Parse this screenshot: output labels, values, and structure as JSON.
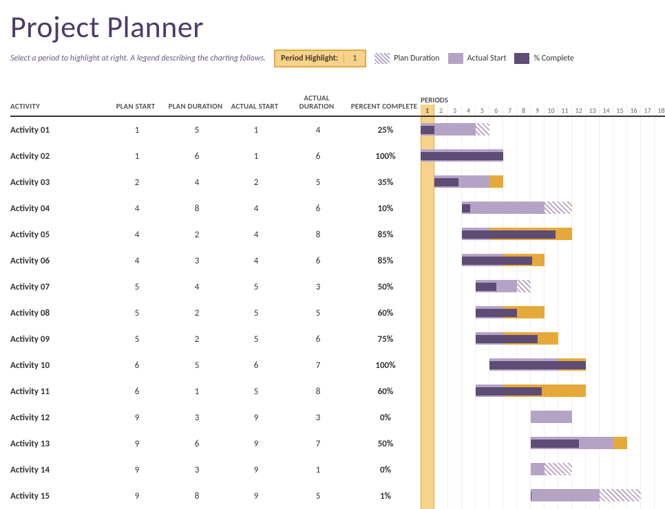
{
  "title": "Project Planner",
  "subtext": "Select a period to highlight at right.  A legend describing the charting follows.",
  "period_highlight_label": "Period Highlight:",
  "period_highlight_value": "1",
  "legend": {
    "plan": "Plan Duration",
    "actual": "Actual Start",
    "complete": "% Complete"
  },
  "columns": {
    "activity": "ACTIVITY",
    "plan_start": "PLAN START",
    "plan_duration": "PLAN DURATION",
    "actual_start": "ACTUAL START",
    "actual_duration": "ACTUAL DURATION",
    "percent_complete": "PERCENT COMPLETE",
    "periods": "PERIODS"
  },
  "period_count": 18,
  "highlight_period": 1,
  "activities": [
    {
      "name": "Activity 01",
      "plan_start": 1,
      "plan_dur": 5,
      "act_start": 1,
      "act_dur": 4,
      "pct": "25%"
    },
    {
      "name": "Activity 02",
      "plan_start": 1,
      "plan_dur": 6,
      "act_start": 1,
      "act_dur": 6,
      "pct": "100%"
    },
    {
      "name": "Activity 03",
      "plan_start": 2,
      "plan_dur": 4,
      "act_start": 2,
      "act_dur": 5,
      "pct": "35%"
    },
    {
      "name": "Activity 04",
      "plan_start": 4,
      "plan_dur": 8,
      "act_start": 4,
      "act_dur": 6,
      "pct": "10%"
    },
    {
      "name": "Activity 05",
      "plan_start": 4,
      "plan_dur": 2,
      "act_start": 4,
      "act_dur": 8,
      "pct": "85%"
    },
    {
      "name": "Activity 06",
      "plan_start": 4,
      "plan_dur": 3,
      "act_start": 4,
      "act_dur": 6,
      "pct": "85%"
    },
    {
      "name": "Activity 07",
      "plan_start": 5,
      "plan_dur": 4,
      "act_start": 5,
      "act_dur": 3,
      "pct": "50%"
    },
    {
      "name": "Activity 08",
      "plan_start": 5,
      "plan_dur": 2,
      "act_start": 5,
      "act_dur": 5,
      "pct": "60%"
    },
    {
      "name": "Activity 09",
      "plan_start": 5,
      "plan_dur": 2,
      "act_start": 5,
      "act_dur": 6,
      "pct": "75%"
    },
    {
      "name": "Activity 10",
      "plan_start": 6,
      "plan_dur": 5,
      "act_start": 6,
      "act_dur": 7,
      "pct": "100%"
    },
    {
      "name": "Activity 11",
      "plan_start": 6,
      "plan_dur": 1,
      "act_start": 5,
      "act_dur": 8,
      "pct": "60%"
    },
    {
      "name": "Activity 12",
      "plan_start": 9,
      "plan_dur": 3,
      "act_start": 9,
      "act_dur": 3,
      "pct": "0%"
    },
    {
      "name": "Activity 13",
      "plan_start": 9,
      "plan_dur": 6,
      "act_start": 9,
      "act_dur": 7,
      "pct": "50%"
    },
    {
      "name": "Activity 14",
      "plan_start": 9,
      "plan_dur": 3,
      "act_start": 9,
      "act_dur": 1,
      "pct": "0%"
    },
    {
      "name": "Activity 15",
      "plan_start": 9,
      "plan_dur": 8,
      "act_start": 9,
      "act_dur": 5,
      "pct": "1%"
    }
  ],
  "chart_data": {
    "type": "gantt",
    "title": "Project Planner",
    "xlabel": "Periods",
    "x_range": [
      1,
      18
    ],
    "legend": [
      "Plan Duration",
      "Actual Start",
      "% Complete"
    ],
    "rows": [
      {
        "name": "Activity 01",
        "plan_start": 1,
        "plan_duration": 5,
        "actual_start": 1,
        "actual_duration": 4,
        "percent_complete": 25
      },
      {
        "name": "Activity 02",
        "plan_start": 1,
        "plan_duration": 6,
        "actual_start": 1,
        "actual_duration": 6,
        "percent_complete": 100
      },
      {
        "name": "Activity 03",
        "plan_start": 2,
        "plan_duration": 4,
        "actual_start": 2,
        "actual_duration": 5,
        "percent_complete": 35
      },
      {
        "name": "Activity 04",
        "plan_start": 4,
        "plan_duration": 8,
        "actual_start": 4,
        "actual_duration": 6,
        "percent_complete": 10
      },
      {
        "name": "Activity 05",
        "plan_start": 4,
        "plan_duration": 2,
        "actual_start": 4,
        "actual_duration": 8,
        "percent_complete": 85
      },
      {
        "name": "Activity 06",
        "plan_start": 4,
        "plan_duration": 3,
        "actual_start": 4,
        "actual_duration": 6,
        "percent_complete": 85
      },
      {
        "name": "Activity 07",
        "plan_start": 5,
        "plan_duration": 4,
        "actual_start": 5,
        "actual_duration": 3,
        "percent_complete": 50
      },
      {
        "name": "Activity 08",
        "plan_start": 5,
        "plan_duration": 2,
        "actual_start": 5,
        "actual_duration": 5,
        "percent_complete": 60
      },
      {
        "name": "Activity 09",
        "plan_start": 5,
        "plan_duration": 2,
        "actual_start": 5,
        "actual_duration": 6,
        "percent_complete": 75
      },
      {
        "name": "Activity 10",
        "plan_start": 6,
        "plan_duration": 5,
        "actual_start": 6,
        "actual_duration": 7,
        "percent_complete": 100
      },
      {
        "name": "Activity 11",
        "plan_start": 6,
        "plan_duration": 1,
        "actual_start": 5,
        "actual_duration": 8,
        "percent_complete": 60
      },
      {
        "name": "Activity 12",
        "plan_start": 9,
        "plan_duration": 3,
        "actual_start": 9,
        "actual_duration": 3,
        "percent_complete": 0
      },
      {
        "name": "Activity 13",
        "plan_start": 9,
        "plan_duration": 6,
        "actual_start": 9,
        "actual_duration": 7,
        "percent_complete": 50
      },
      {
        "name": "Activity 14",
        "plan_start": 9,
        "plan_duration": 3,
        "actual_start": 9,
        "actual_duration": 1,
        "percent_complete": 0
      },
      {
        "name": "Activity 15",
        "plan_start": 9,
        "plan_duration": 8,
        "actual_start": 9,
        "actual_duration": 5,
        "percent_complete": 1
      }
    ]
  }
}
